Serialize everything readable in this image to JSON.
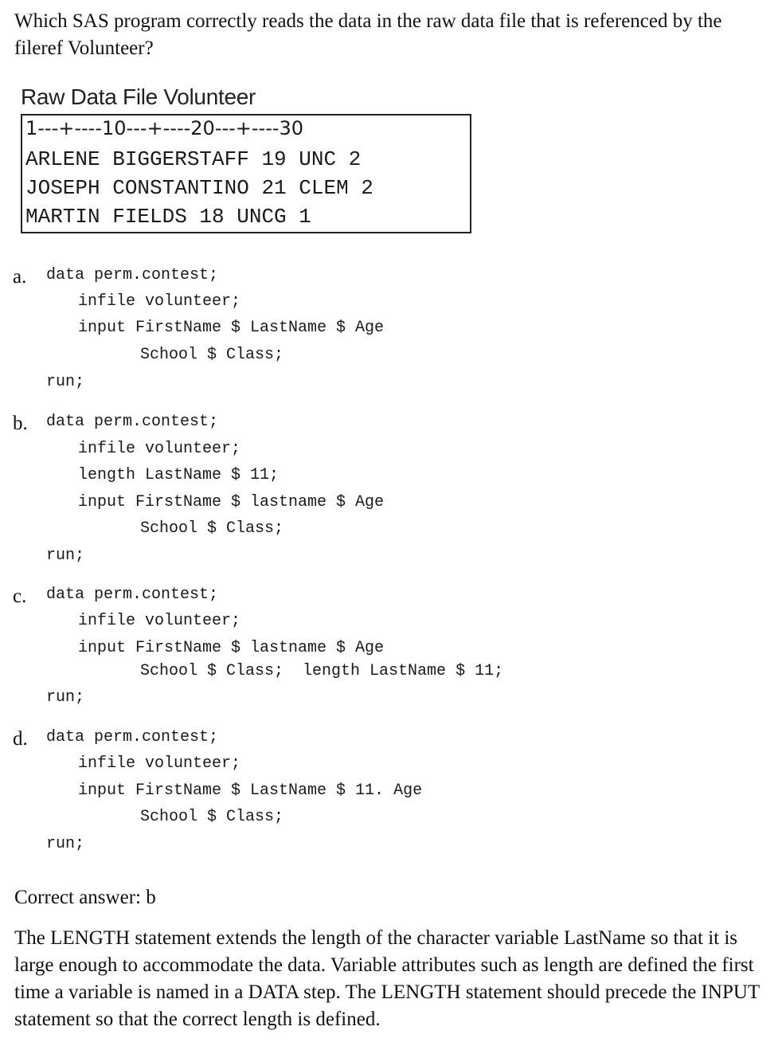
{
  "question": "Which SAS program correctly reads the data in the raw data file that is referenced by the fileref Volunteer?",
  "raw_file": {
    "title": "Raw Data File Volunteer",
    "ruler": "1---+----10---+----20---+----30",
    "rows": [
      "ARLENE BIGGERSTAFF 19 UNC 2",
      "JOSEPH CONSTANTINO 21 CLEM 2",
      "MARTIN FIELDS 18 UNCG 1"
    ]
  },
  "options": [
    {
      "letter": "a.",
      "lines": [
        "data perm.contest;",
        "infile volunteer;",
        "input FirstName $ LastName $ Age",
        "School $ Class;",
        "run;"
      ]
    },
    {
      "letter": "b.",
      "lines": [
        "data perm.contest;",
        "infile volunteer;",
        "length LastName $ 11;",
        "input FirstName $ lastname $ Age",
        "School $ Class;",
        "run;"
      ]
    },
    {
      "letter": "c.",
      "lines": [
        "data perm.contest;",
        "infile volunteer;",
        "input FirstName $ lastname $ Age",
        "School $ Class;  length LastName $ 11;",
        "run;"
      ]
    },
    {
      "letter": "d.",
      "lines": [
        "data perm.contest;",
        "infile volunteer;",
        "input FirstName $ LastName $ 11. Age",
        "School $ Class;",
        "run;"
      ]
    }
  ],
  "answer": "Correct answer: b",
  "explanation": "The LENGTH statement extends the length of the character variable LastName so that it is large enough to accommodate the data. Variable attributes such as length are defined the first time a variable is named in a DATA step. The LENGTH statement should precede the INPUT statement so that the correct length is defined."
}
